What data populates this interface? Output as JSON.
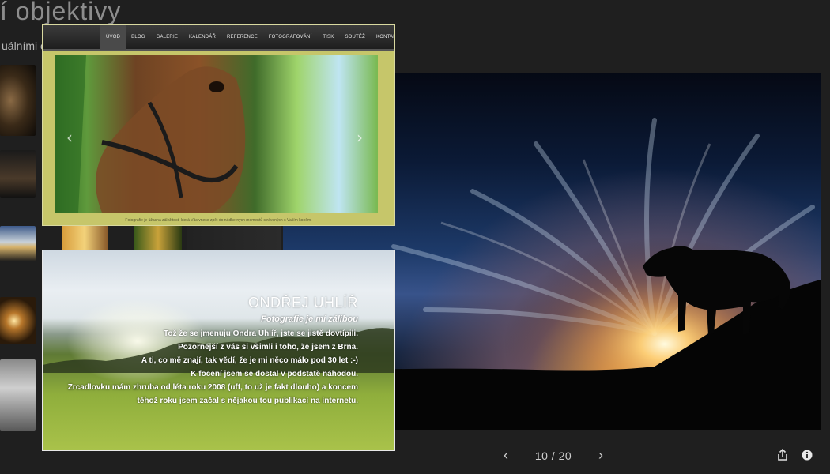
{
  "background_page": {
    "title_fragment": "í objektivy",
    "subtitle_fragment": "uálními o"
  },
  "viewer": {
    "counter": "10 / 20",
    "prev_icon": "chevron-left-icon",
    "next_icon": "chevron-right-icon",
    "share_icon": "share-icon",
    "info_icon": "info-icon"
  },
  "website_screenshot_1": {
    "nav": [
      "Úvod",
      "Blog",
      "Galerie",
      "Kalendář akcí",
      "Reference",
      "Fotografování",
      "Tisk",
      "Soutěž",
      "Kontakt"
    ],
    "caption": "Fotografie je úžasná záležitost, která Vás vnese zpět do nádherných momentů strávených s Vaším koněm."
  },
  "website_screenshot_2": {
    "name": "ONDŘEJ UHLÍŘ",
    "lead": "Fotografie je mí zálibou",
    "lines": [
      "Tož že se jmenuju Ondra Uhlíř, jste se jistě dovtípili.",
      "Pozornější z vás si všimli i toho, že jsem z Brna.",
      "A ti, co mě znají, tak vědí, že je mi něco málo pod 30 let :-)",
      "K focení jsem se dostal v podstatě náhodou.",
      "Zrcadlovku mám zhruba od léta roku 2008 (uff, to už je fakt dlouho) a koncem",
      "téhož roku jsem začal s nějakou tou publikací na internetu."
    ]
  },
  "colors": {
    "background": "#1f1f1f",
    "viewer_text": "#cfcfcf",
    "site1_frame": "#c6c66a"
  }
}
